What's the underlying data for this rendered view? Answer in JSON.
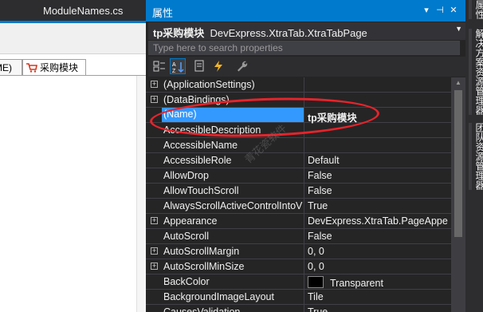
{
  "document": {
    "tab_title": "ModuleNames.cs",
    "xtab_partial": "ME)",
    "xtab_label": "采购模块"
  },
  "properties": {
    "title": "属性",
    "pin_glyph": "⊣",
    "dropdown_glyph": "▾",
    "close_glyph": "✕",
    "object_name": "tp采购模块",
    "object_type": "DevExpress.XtraTab.XtraTabPage",
    "search_placeholder": "Type here to search properties",
    "rows": [
      {
        "name": "(ApplicationSettings)",
        "value": "",
        "expandable": true
      },
      {
        "name": "(DataBindings)",
        "value": "",
        "expandable": true
      },
      {
        "name": "(Name)",
        "value": "tp采购模块",
        "expandable": false,
        "selected": true
      },
      {
        "name": "AccessibleDescription",
        "value": "",
        "expandable": false
      },
      {
        "name": "AccessibleName",
        "value": "",
        "expandable": false
      },
      {
        "name": "AccessibleRole",
        "value": "Default",
        "expandable": false
      },
      {
        "name": "AllowDrop",
        "value": "False",
        "expandable": false
      },
      {
        "name": "AllowTouchScroll",
        "value": "False",
        "expandable": false
      },
      {
        "name": "AlwaysScrollActiveControlIntoV",
        "value": "True",
        "expandable": false
      },
      {
        "name": "Appearance",
        "value": "DevExpress.XtraTab.PageAppe",
        "expandable": true
      },
      {
        "name": "AutoScroll",
        "value": "False",
        "expandable": false
      },
      {
        "name": "AutoScrollMargin",
        "value": "0, 0",
        "expandable": true
      },
      {
        "name": "AutoScrollMinSize",
        "value": "0, 0",
        "expandable": true
      },
      {
        "name": "BackColor",
        "value": "Transparent",
        "expandable": false,
        "swatch": "#000000"
      },
      {
        "name": "BackgroundImageLayout",
        "value": "Tile",
        "expandable": false
      },
      {
        "name": "CausesValidation",
        "value": "True",
        "expandable": false
      }
    ]
  },
  "side_panels": [
    "解决方案资源管理器",
    "团队资源管理器"
  ],
  "watermark": "青花瓷软件",
  "colors": {
    "accent": "#007acc",
    "selection": "#3399ff",
    "annotation": "#e8232a"
  }
}
